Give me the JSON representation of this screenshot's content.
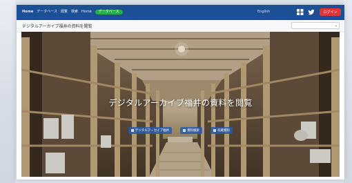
{
  "topbar": {
    "nav": [
      "Home",
      "データベース",
      "閲覧",
      "検索",
      "Home"
    ],
    "badge": "データベース",
    "language": "English",
    "button": "ログイン",
    "colors": {
      "bar": "#1d4f94",
      "badge": "#21b04b",
      "button": "#e23434"
    }
  },
  "header": {
    "site_title": "デジタルアーカイブ福井の資料を閲覧",
    "select_value": ""
  },
  "hero": {
    "title": "デジタルアーカイブ福井の資料を閲覧",
    "buttons": [
      "デジタルアーカイブ福井",
      "資料検索",
      "収蔵資料"
    ]
  },
  "icons": [
    "grid-icon",
    "twitter-icon",
    "sort-icon"
  ]
}
